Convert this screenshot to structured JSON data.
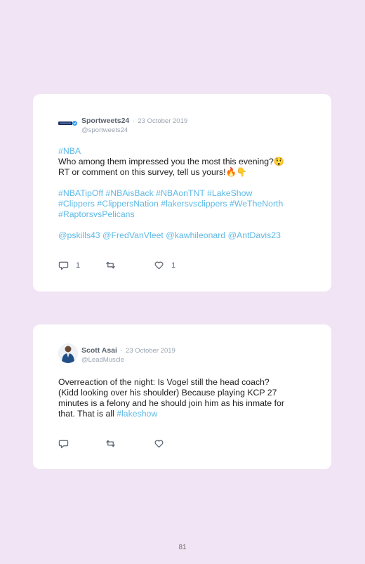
{
  "tweets": [
    {
      "name": "Sportweets24",
      "separator": "·",
      "date": "23 October 2019",
      "handle": "@sportweets24",
      "line1_tag": "#NBA",
      "line2": "Who among them impressed you the most this evening?😲",
      "line3": "RT or comment on this survey, tell us yours!🔥👇",
      "hashtags1": "#NBATipOff #NBAisBack #NBAonTNT #LakeShow",
      "hashtags2": "#Clippers #ClippersNation #lakersvsclippers #WeTheNorth",
      "hashtags3": "#RaptorsvsPelicans",
      "mentions": "@pskills43 @FredVanVleet @kawhileonard @AntDavis23",
      "reply_count": "1",
      "like_count": "1"
    },
    {
      "name": "Scott Asai",
      "separator": "·",
      "date": "23 October 2019",
      "handle": "@LeadMuscle",
      "text_l1": "Overreaction of the night: Is Vogel still the head coach?",
      "text_l2": "(Kidd looking over his shoulder) Because playing KCP 27",
      "text_l3": "minutes is a felony and he should join him as his inmate for",
      "text_l4_plain": "that. That is all ",
      "text_l4_tag": "#lakeshow"
    }
  ],
  "page_number": "81",
  "colors": {
    "background": "#f1e4f4",
    "hashtag": "#5fb9e6",
    "meta": "#9aa5b1"
  },
  "icons": [
    "reply-icon",
    "retweet-icon",
    "like-icon",
    "verified-icon"
  ]
}
